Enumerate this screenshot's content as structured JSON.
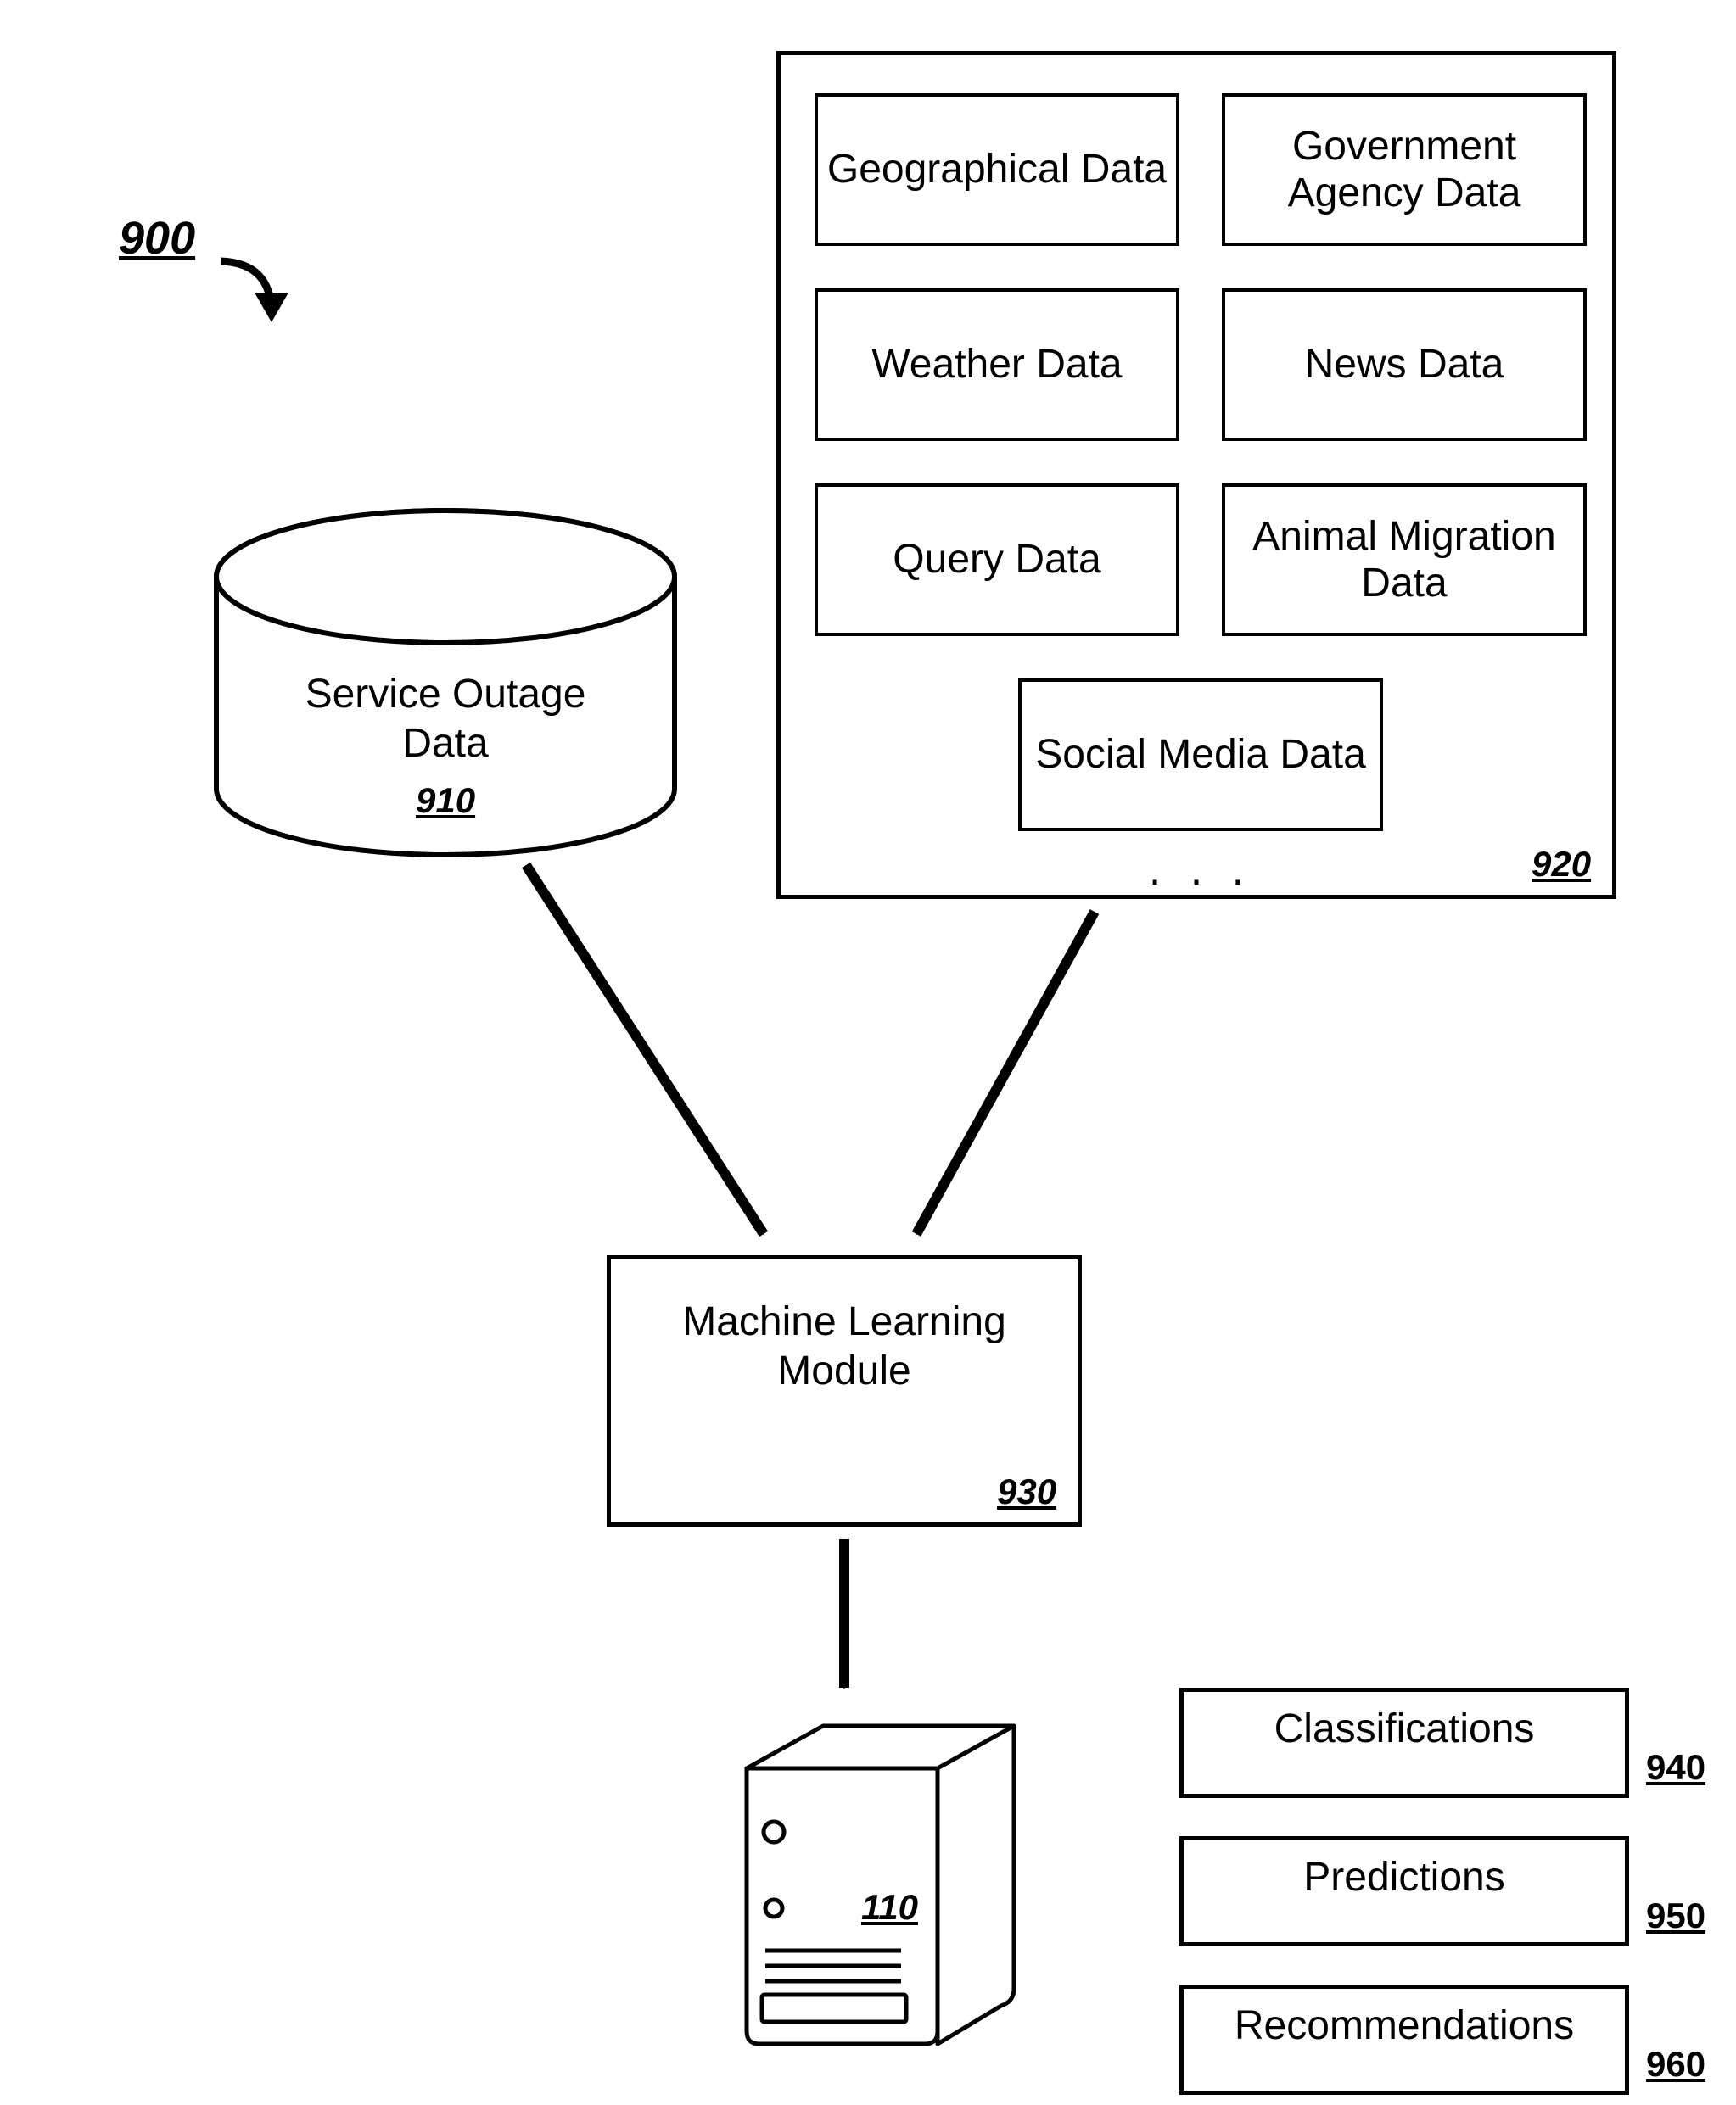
{
  "figure_number": "900",
  "database": {
    "label": "Service Outage\nData",
    "ref": "910"
  },
  "sources": {
    "ref": "920",
    "ellipsis": ". . .",
    "items": [
      "Geographical\nData",
      "Government\nAgency Data",
      "Weather Data",
      "News Data",
      "Query Data",
      "Animal\nMigration Data",
      "Social Media\nData"
    ]
  },
  "ml_module": {
    "label": "Machine Learning\nModule",
    "ref": "930"
  },
  "server": {
    "ref": "110"
  },
  "outputs": [
    {
      "label": "Classifications",
      "ref": "940"
    },
    {
      "label": "Predictions",
      "ref": "950"
    },
    {
      "label": "Recommendations",
      "ref": "960"
    }
  ]
}
